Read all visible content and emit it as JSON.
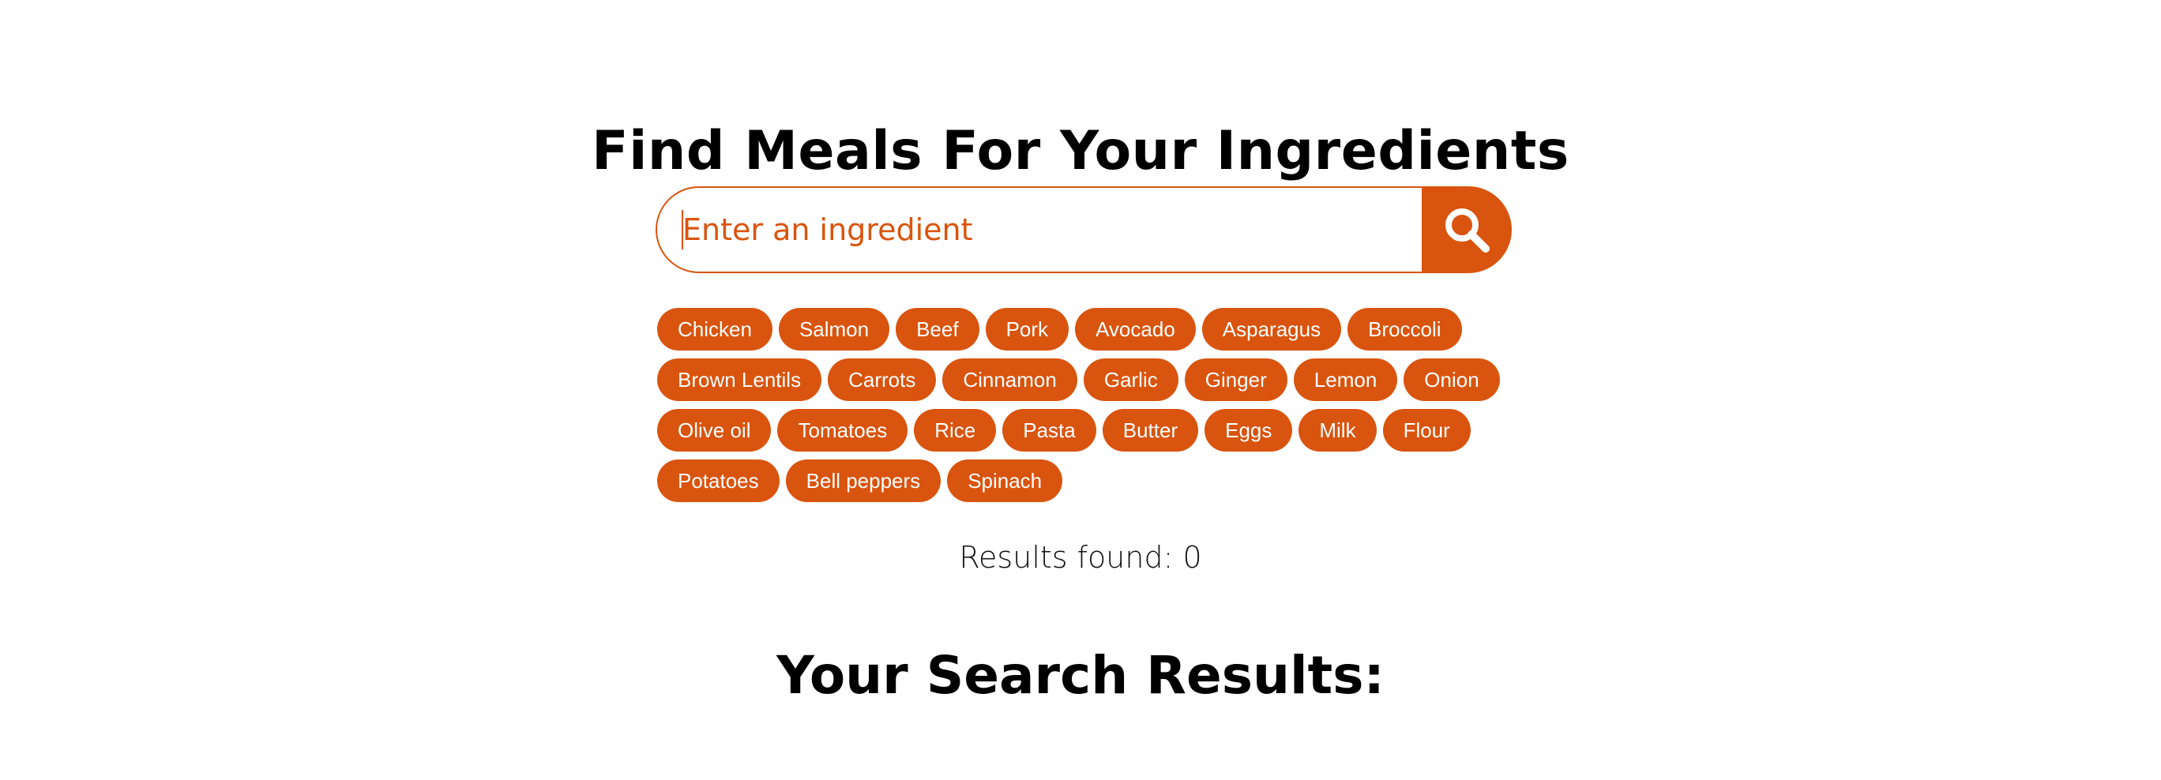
{
  "header": {
    "title": "Find Meals For Your Ingredients"
  },
  "search": {
    "placeholder": "Enter an ingredient",
    "value": "",
    "button_icon": "search-icon"
  },
  "ingredients": [
    "Chicken",
    "Salmon",
    "Beef",
    "Pork",
    "Avocado",
    "Asparagus",
    "Broccoli",
    "Brown Lentils",
    "Carrots",
    "Cinnamon",
    "Garlic",
    "Ginger",
    "Lemon",
    "Onion",
    "Olive oil",
    "Tomatoes",
    "Rice",
    "Pasta",
    "Butter",
    "Eggs",
    "Milk",
    "Flour",
    "Potatoes",
    "Bell peppers",
    "Spinach"
  ],
  "results": {
    "count_text": "Results found: 0",
    "heading": "Your Search Results:"
  },
  "colors": {
    "accent": "#d9540e",
    "background": "#ffffff",
    "text": "#000000"
  }
}
